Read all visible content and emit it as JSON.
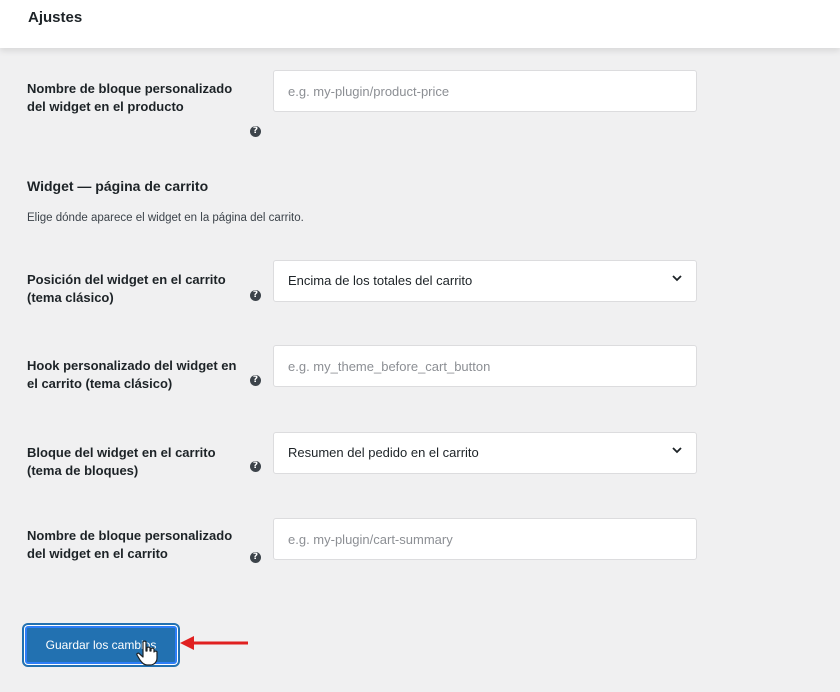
{
  "header": {
    "title": "Ajustes"
  },
  "product_block": {
    "label": "Nombre de bloque personalizado del widget en el producto",
    "placeholder": "e.g. my-plugin/product-price"
  },
  "cart_section": {
    "title": "Widget — página de carrito",
    "description": "Elige dónde aparece el widget en la página del carrito.",
    "fields": [
      {
        "label": "Posición del widget en el carrito (tema clásico)",
        "type": "select",
        "value": "Encima de los totales del carrito"
      },
      {
        "label": "Hook personalizado del widget en el carrito (tema clásico)",
        "type": "text",
        "placeholder": "e.g. my_theme_before_cart_button"
      },
      {
        "label": "Bloque del widget en el carrito (tema de bloques)",
        "type": "select",
        "value": "Resumen del pedido en el carrito"
      },
      {
        "label": "Nombre de bloque personalizado del widget en el carrito",
        "type": "text",
        "placeholder": "e.g. my-plugin/cart-summary"
      }
    ]
  },
  "help_icon": {
    "name": "help-icon",
    "glyph": "?"
  },
  "save_button": {
    "label": "Guardar los cambios"
  },
  "colors": {
    "accent": "#2271b1",
    "arrow": "#e02020",
    "background": "#f0f0f1"
  }
}
